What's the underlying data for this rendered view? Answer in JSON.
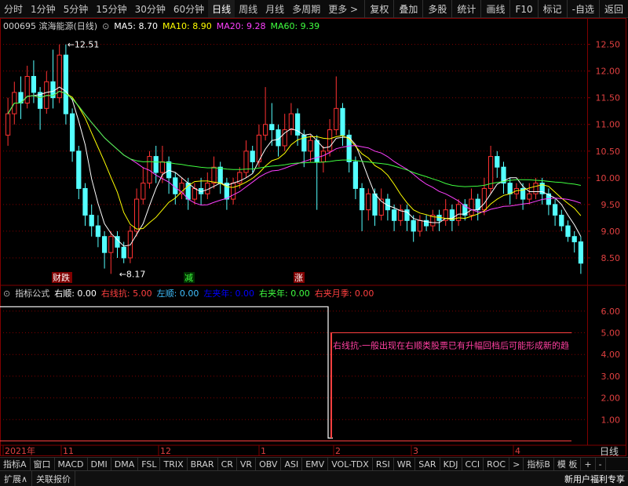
{
  "toolbar": {
    "periods": [
      "分时",
      "1分钟",
      "5分钟",
      "15分钟",
      "30分钟",
      "60分钟",
      "日线",
      "周线",
      "月线",
      "多周期",
      "更多 >"
    ],
    "active_period": "日线",
    "right_tools": [
      "复权",
      "叠加",
      "多股",
      "统计",
      "画线",
      "F10",
      "标记",
      "-自选",
      "返回"
    ]
  },
  "stock": {
    "code_name": "000695 滨海能源(日线)",
    "ma_legend": [
      {
        "label": "MA5: 8.70",
        "color": "#ffffff"
      },
      {
        "label": "MA10: 8.90",
        "color": "#ffff00"
      },
      {
        "label": "MA20: 9.28",
        "color": "#ff40ff"
      },
      {
        "label": "MA60: 9.39",
        "color": "#40ff40"
      }
    ],
    "price_axis": [
      "12.50",
      "12.00",
      "11.50",
      "11.00",
      "10.50",
      "10.00",
      "9.50",
      "9.00",
      "8.50"
    ],
    "high_label": "12.51",
    "low_label": "8.17",
    "signals": [
      {
        "text": "财跌",
        "color": "#ffffff",
        "bg": "#800000"
      },
      {
        "text": "减",
        "color": "#40ff40",
        "bg": "#003000"
      },
      {
        "text": "涨",
        "color": "#ffffff",
        "bg": "#800000"
      }
    ]
  },
  "indicator": {
    "legend": [
      {
        "label": "指标公式",
        "color": "#d0d0d0"
      },
      {
        "label": "右顺: 0.00",
        "color": "#ffffff"
      },
      {
        "label": "右线抗: 5.00",
        "color": "#ff4040"
      },
      {
        "label": "左顺: 0.00",
        "color": "#40c0ff"
      },
      {
        "label": "左夹年: 0.00",
        "color": "#0000ff"
      },
      {
        "label": "右夹年: 0.00",
        "color": "#40ff40"
      },
      {
        "label": "右夹月季: 0.00",
        "color": "#ff4040"
      }
    ],
    "axis": [
      "6.00",
      "5.00",
      "4.00",
      "3.00",
      "2.00",
      "1.00"
    ],
    "annotation": "右线抗-一般出现在右顺类股票已有升幅回档后可能形成新的趋"
  },
  "date_axis": {
    "labels": [
      "2021年",
      "11",
      "12",
      "1",
      "2",
      "3",
      "4"
    ],
    "period_label": "日线"
  },
  "indicator_tabs": [
    "指标A",
    "窗口",
    "MACD",
    "DMI",
    "DMA",
    "FSL",
    "TRIX",
    "BRAR",
    "CR",
    "VR",
    "OBV",
    "ASI",
    "EMV",
    "VOL-TDX",
    "RSI",
    "WR",
    "SAR",
    "KDJ",
    "CCI",
    "ROC",
    ">",
    "指标B",
    "模 板",
    "+",
    "-"
  ],
  "statusbar": {
    "buttons": [
      "扩展∧",
      "关联报价"
    ],
    "welfare": "新用户福利专享"
  },
  "colors": {
    "up": "#ff3232",
    "down": "#54ffff",
    "grid": "#800000",
    "bg": "#000000"
  },
  "chart_data": {
    "type": "candlestick",
    "price_ylim": [
      8.0,
      12.7
    ],
    "indicator_ylim": [
      0,
      6.5
    ],
    "candles": [
      [
        10.8,
        11.2,
        11.5,
        10.6
      ],
      [
        11.2,
        11.6,
        11.8,
        11.0
      ],
      [
        11.6,
        11.4,
        11.9,
        11.1
      ],
      [
        11.4,
        11.9,
        12.1,
        11.3
      ],
      [
        11.9,
        11.6,
        12.2,
        11.4
      ],
      [
        11.6,
        11.3,
        11.7,
        10.9
      ],
      [
        11.3,
        11.8,
        12.0,
        11.2
      ],
      [
        11.8,
        11.5,
        12.4,
        11.3
      ],
      [
        11.5,
        12.3,
        12.5,
        11.4
      ],
      [
        12.3,
        11.2,
        12.5,
        11.0
      ],
      [
        11.2,
        10.5,
        11.3,
        10.3
      ],
      [
        10.5,
        9.8,
        10.6,
        9.6
      ],
      [
        9.8,
        9.3,
        9.9,
        9.1
      ],
      [
        9.3,
        9.1,
        9.5,
        8.9
      ],
      [
        9.1,
        8.9,
        9.3,
        8.7
      ],
      [
        8.9,
        8.6,
        9.0,
        8.3
      ],
      [
        8.6,
        8.9,
        9.0,
        8.2
      ],
      [
        8.9,
        8.7,
        9.0,
        8.5
      ],
      [
        8.7,
        8.5,
        8.8,
        8.4
      ],
      [
        8.5,
        9.0,
        9.1,
        8.4
      ],
      [
        9.0,
        9.6,
        9.8,
        8.9
      ],
      [
        9.6,
        9.9,
        10.2,
        9.5
      ],
      [
        9.9,
        10.4,
        10.5,
        9.8
      ],
      [
        10.4,
        10.1,
        10.6,
        9.9
      ],
      [
        10.1,
        10.3,
        10.6,
        9.9
      ],
      [
        10.3,
        10.0,
        10.4,
        9.7
      ],
      [
        10.0,
        9.7,
        10.1,
        9.5
      ],
      [
        9.7,
        9.9,
        10.0,
        9.6
      ],
      [
        9.9,
        9.6,
        10.0,
        9.4
      ],
      [
        9.6,
        9.8,
        9.9,
        9.5
      ],
      [
        9.8,
        9.7,
        10.0,
        9.5
      ],
      [
        9.7,
        9.9,
        10.1,
        9.6
      ],
      [
        9.9,
        10.2,
        10.4,
        9.8
      ],
      [
        10.2,
        9.9,
        10.3,
        9.7
      ],
      [
        9.9,
        9.6,
        10.0,
        9.4
      ],
      [
        9.6,
        9.9,
        10.0,
        9.5
      ],
      [
        9.9,
        10.1,
        10.2,
        9.8
      ],
      [
        10.1,
        10.5,
        10.7,
        10.0
      ],
      [
        10.5,
        10.3,
        10.6,
        10.1
      ],
      [
        10.3,
        10.8,
        11.0,
        10.2
      ],
      [
        10.8,
        11.0,
        11.7,
        10.7
      ],
      [
        11.0,
        10.9,
        11.4,
        10.6
      ],
      [
        10.9,
        10.6,
        11.0,
        10.4
      ],
      [
        10.6,
        10.9,
        11.2,
        10.5
      ],
      [
        10.9,
        11.2,
        11.4,
        10.8
      ],
      [
        11.2,
        10.8,
        11.3,
        10.6
      ],
      [
        10.8,
        10.5,
        10.9,
        10.2
      ],
      [
        10.5,
        10.7,
        10.8,
        10.3
      ],
      [
        10.7,
        10.3,
        10.8,
        9.4
      ],
      [
        10.3,
        10.5,
        10.6,
        10.1
      ],
      [
        10.5,
        10.9,
        11.1,
        10.4
      ],
      [
        10.9,
        11.3,
        11.9,
        10.8
      ],
      [
        11.3,
        10.8,
        11.4,
        10.6
      ],
      [
        10.8,
        10.3,
        10.9,
        10.1
      ],
      [
        10.3,
        9.8,
        10.4,
        9.6
      ],
      [
        9.8,
        9.4,
        9.9,
        9.0
      ],
      [
        9.4,
        9.7,
        9.8,
        9.2
      ],
      [
        9.7,
        9.3,
        9.8,
        9.1
      ],
      [
        9.3,
        9.6,
        9.8,
        9.2
      ],
      [
        9.6,
        9.4,
        9.7,
        9.2
      ],
      [
        9.4,
        9.2,
        9.5,
        9.0
      ],
      [
        9.2,
        9.4,
        9.5,
        9.1
      ],
      [
        9.4,
        9.2,
        9.5,
        9.0
      ],
      [
        9.2,
        9.0,
        9.3,
        8.8
      ],
      [
        9.0,
        9.2,
        9.3,
        8.9
      ],
      [
        9.2,
        9.1,
        9.3,
        9.0
      ],
      [
        9.1,
        9.3,
        9.4,
        9.0
      ],
      [
        9.3,
        9.2,
        9.4,
        9.0
      ],
      [
        9.2,
        9.4,
        9.6,
        9.1
      ],
      [
        9.4,
        9.2,
        9.5,
        9.0
      ],
      [
        9.2,
        9.5,
        9.6,
        9.1
      ],
      [
        9.5,
        9.3,
        9.6,
        9.2
      ],
      [
        9.3,
        9.6,
        9.8,
        9.2
      ],
      [
        9.6,
        9.4,
        9.7,
        9.2
      ],
      [
        9.4,
        9.8,
        10.0,
        9.3
      ],
      [
        9.8,
        10.4,
        10.6,
        9.7
      ],
      [
        10.4,
        10.2,
        10.5,
        10.0
      ],
      [
        10.2,
        9.9,
        10.3,
        9.7
      ],
      [
        9.9,
        9.7,
        10.0,
        9.5
      ],
      [
        9.7,
        9.8,
        9.9,
        9.6
      ],
      [
        9.8,
        9.6,
        9.9,
        9.4
      ],
      [
        9.6,
        9.7,
        9.9,
        9.5
      ],
      [
        9.7,
        9.9,
        10.0,
        9.6
      ],
      [
        9.9,
        9.7,
        10.0,
        9.5
      ],
      [
        9.7,
        9.5,
        9.8,
        9.3
      ],
      [
        9.5,
        9.3,
        9.6,
        9.1
      ],
      [
        9.3,
        9.1,
        9.4,
        9.0
      ],
      [
        9.1,
        8.9,
        9.2,
        8.8
      ],
      [
        8.9,
        8.8,
        9.0,
        8.6
      ],
      [
        8.8,
        8.4,
        8.9,
        8.2
      ]
    ],
    "indicator_series": [
      {
        "name": "右线抗",
        "color": "#ff4040"
      }
    ]
  }
}
